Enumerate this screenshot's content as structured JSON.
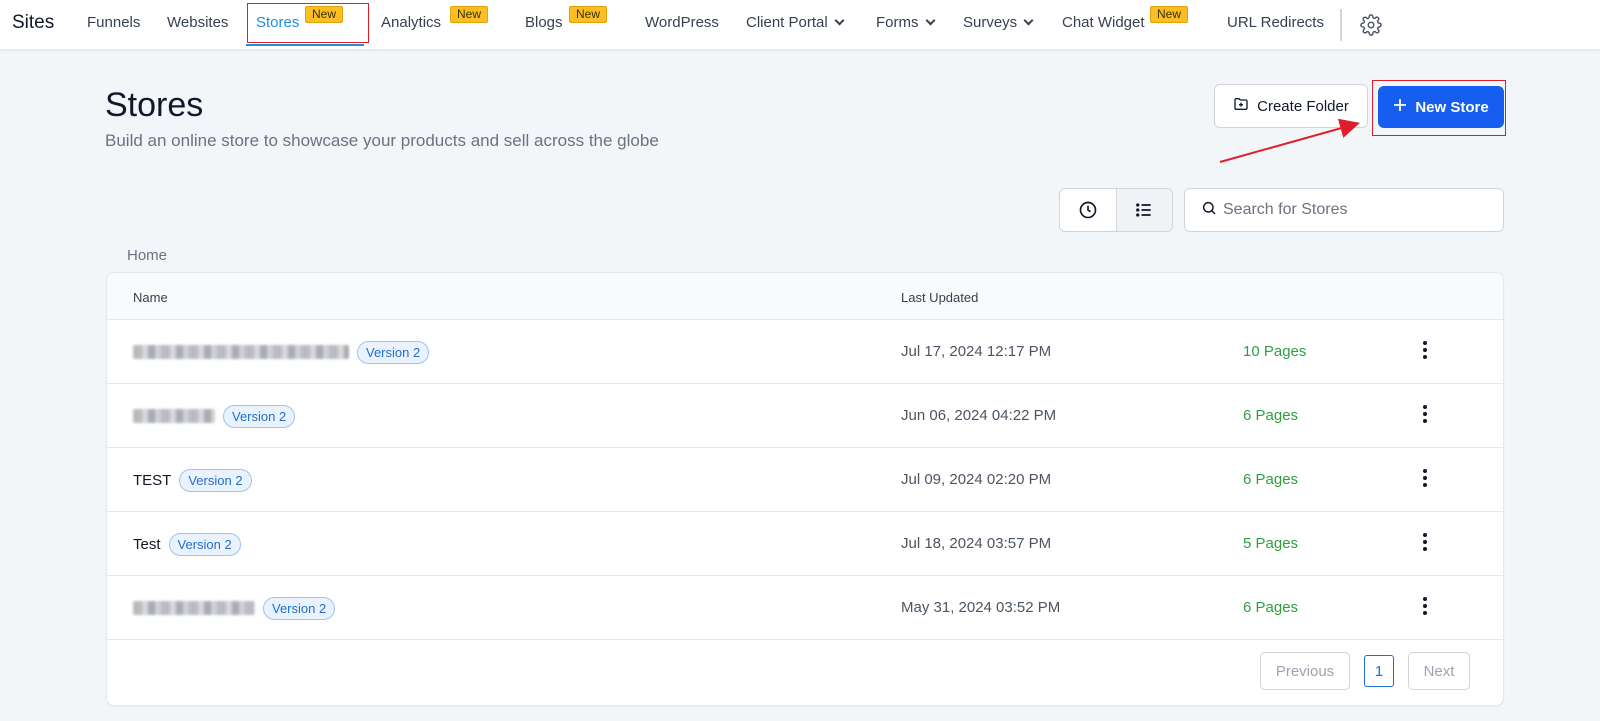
{
  "nav": {
    "brand": "Sites",
    "items": [
      {
        "label": "Funnels"
      },
      {
        "label": "Websites"
      },
      {
        "label": "Stores",
        "badge": "New"
      },
      {
        "label": "Analytics",
        "badge": "New"
      },
      {
        "label": "Blogs",
        "badge": "New"
      },
      {
        "label": "WordPress"
      },
      {
        "label": "Client Portal"
      },
      {
        "label": "Forms"
      },
      {
        "label": "Surveys"
      },
      {
        "label": "Chat Widget",
        "badge": "New"
      },
      {
        "label": "URL Redirects"
      }
    ],
    "settings_icon": "gear-icon"
  },
  "header": {
    "title": "Stores",
    "subtitle": "Build an online store to showcase your products and sell across the globe",
    "create_folder_label": "Create Folder",
    "new_store_label": "New Store"
  },
  "toolbar": {
    "search_placeholder": "Search for Stores",
    "view_icons": [
      "clock-icon",
      "list-icon"
    ]
  },
  "breadcrumb": "Home",
  "table": {
    "columns": [
      "Name",
      "Last Updated"
    ],
    "rows": [
      {
        "name": "",
        "version": "Version 2",
        "updated": "Jul 17, 2024 12:17 PM",
        "pages": "10 Pages"
      },
      {
        "name": "",
        "version": "Version 2",
        "updated": "Jun 06, 2024 04:22 PM",
        "pages": "6 Pages"
      },
      {
        "name": "TEST",
        "version": "Version 2",
        "updated": "Jul 09, 2024 02:20 PM",
        "pages": "6 Pages"
      },
      {
        "name": "Test",
        "version": "Version 2",
        "updated": "Jul 18, 2024 03:57 PM",
        "pages": "5 Pages"
      },
      {
        "name": "",
        "version": "Version 2",
        "updated": "May 31, 2024 03:52 PM",
        "pages": "6 Pages"
      }
    ]
  },
  "pagination": {
    "previous": "Previous",
    "current": "1",
    "next": "Next"
  },
  "colors": {
    "accent": "#155eef",
    "active_tab": "#1d8fe0",
    "badge": "#fbbf24",
    "pages_green": "#2f9e44",
    "highlight": "#e11d2b"
  }
}
